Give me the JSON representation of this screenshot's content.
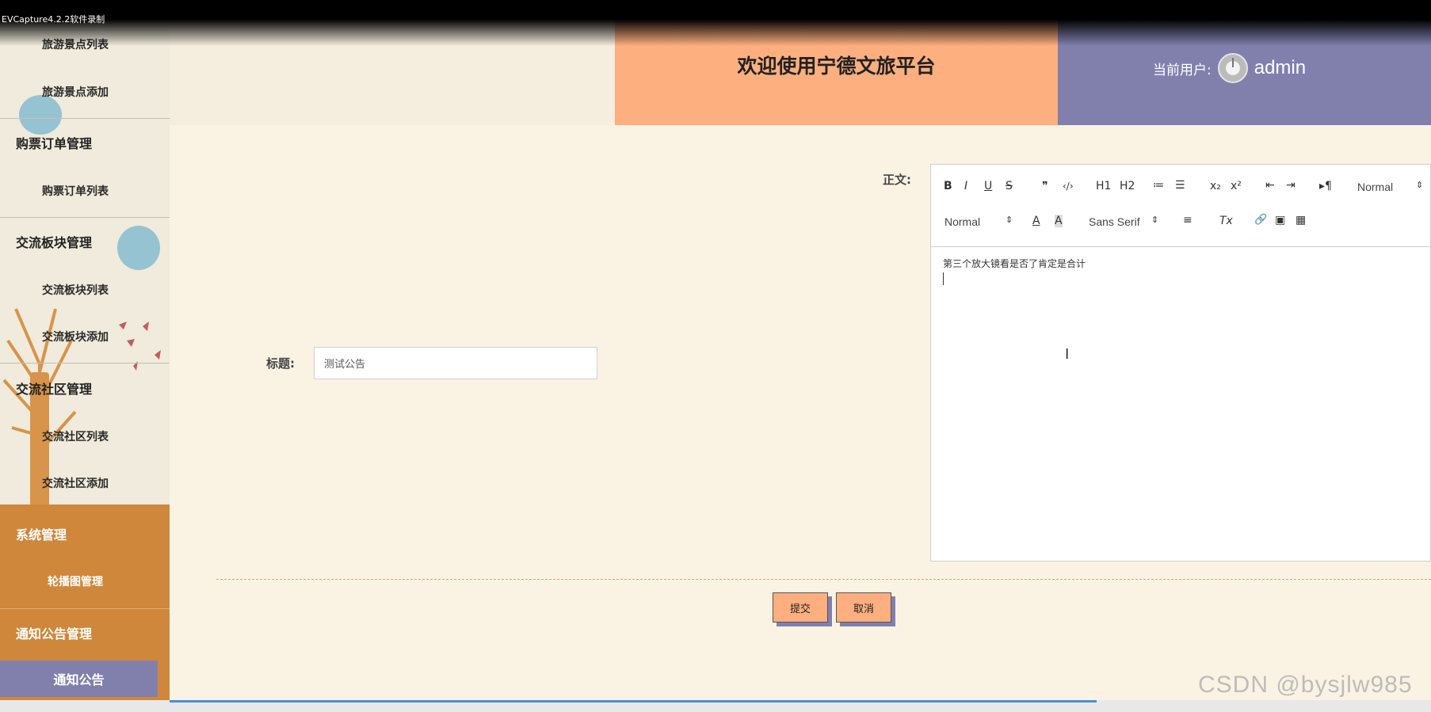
{
  "recorder": {
    "label": "EVCapture4.2.2软件录制"
  },
  "header": {
    "title": "欢迎使用宁德文旅平台",
    "user_label": "当前用户:",
    "user_name": "admin"
  },
  "sidebar": {
    "items": [
      {
        "label": "旅游景点列表",
        "kind": "sub"
      },
      {
        "label": "旅游景点添加",
        "kind": "sub"
      },
      {
        "label": "购票订单管理",
        "kind": "group"
      },
      {
        "label": "购票订单列表",
        "kind": "sub"
      },
      {
        "label": "交流板块管理",
        "kind": "group"
      },
      {
        "label": "交流板块列表",
        "kind": "sub"
      },
      {
        "label": "交流板块添加",
        "kind": "sub"
      },
      {
        "label": "交流社区管理",
        "kind": "group"
      },
      {
        "label": "交流社区列表",
        "kind": "sub"
      },
      {
        "label": "交流社区添加",
        "kind": "sub"
      },
      {
        "label": "系统管理",
        "kind": "group"
      },
      {
        "label": "轮播图管理",
        "kind": "sub"
      },
      {
        "label": "通知公告管理",
        "kind": "group"
      },
      {
        "label": "通知公告",
        "kind": "active"
      }
    ]
  },
  "form": {
    "title_label": "标题:",
    "title_value": "测试公告",
    "body_label": "正文:",
    "body_content": "第三个放大镜看是否了肯定是合计",
    "submit_label": "提交",
    "cancel_label": "取消"
  },
  "editor": {
    "toolbar_row1": [
      "B",
      "I",
      "U",
      "S",
      "❞",
      "‹/›",
      "H1",
      "H2",
      "≔",
      "☰",
      "x₂",
      "x²",
      "⇤",
      "⇥",
      "▸¶"
    ],
    "header_select": "Normal",
    "size_select": "Normal",
    "font_select": "Sans Serif",
    "toolbar_row2": [
      "A",
      "A",
      "≡",
      "Tx",
      "🔗",
      "▣",
      "▦"
    ]
  },
  "watermark": "CSDN @bysjlw985",
  "colors": {
    "accent_orange": "#feaf7f",
    "accent_purple": "#8180ad",
    "sidebar_orange": "#cf873b",
    "background": "#faf3e4"
  }
}
